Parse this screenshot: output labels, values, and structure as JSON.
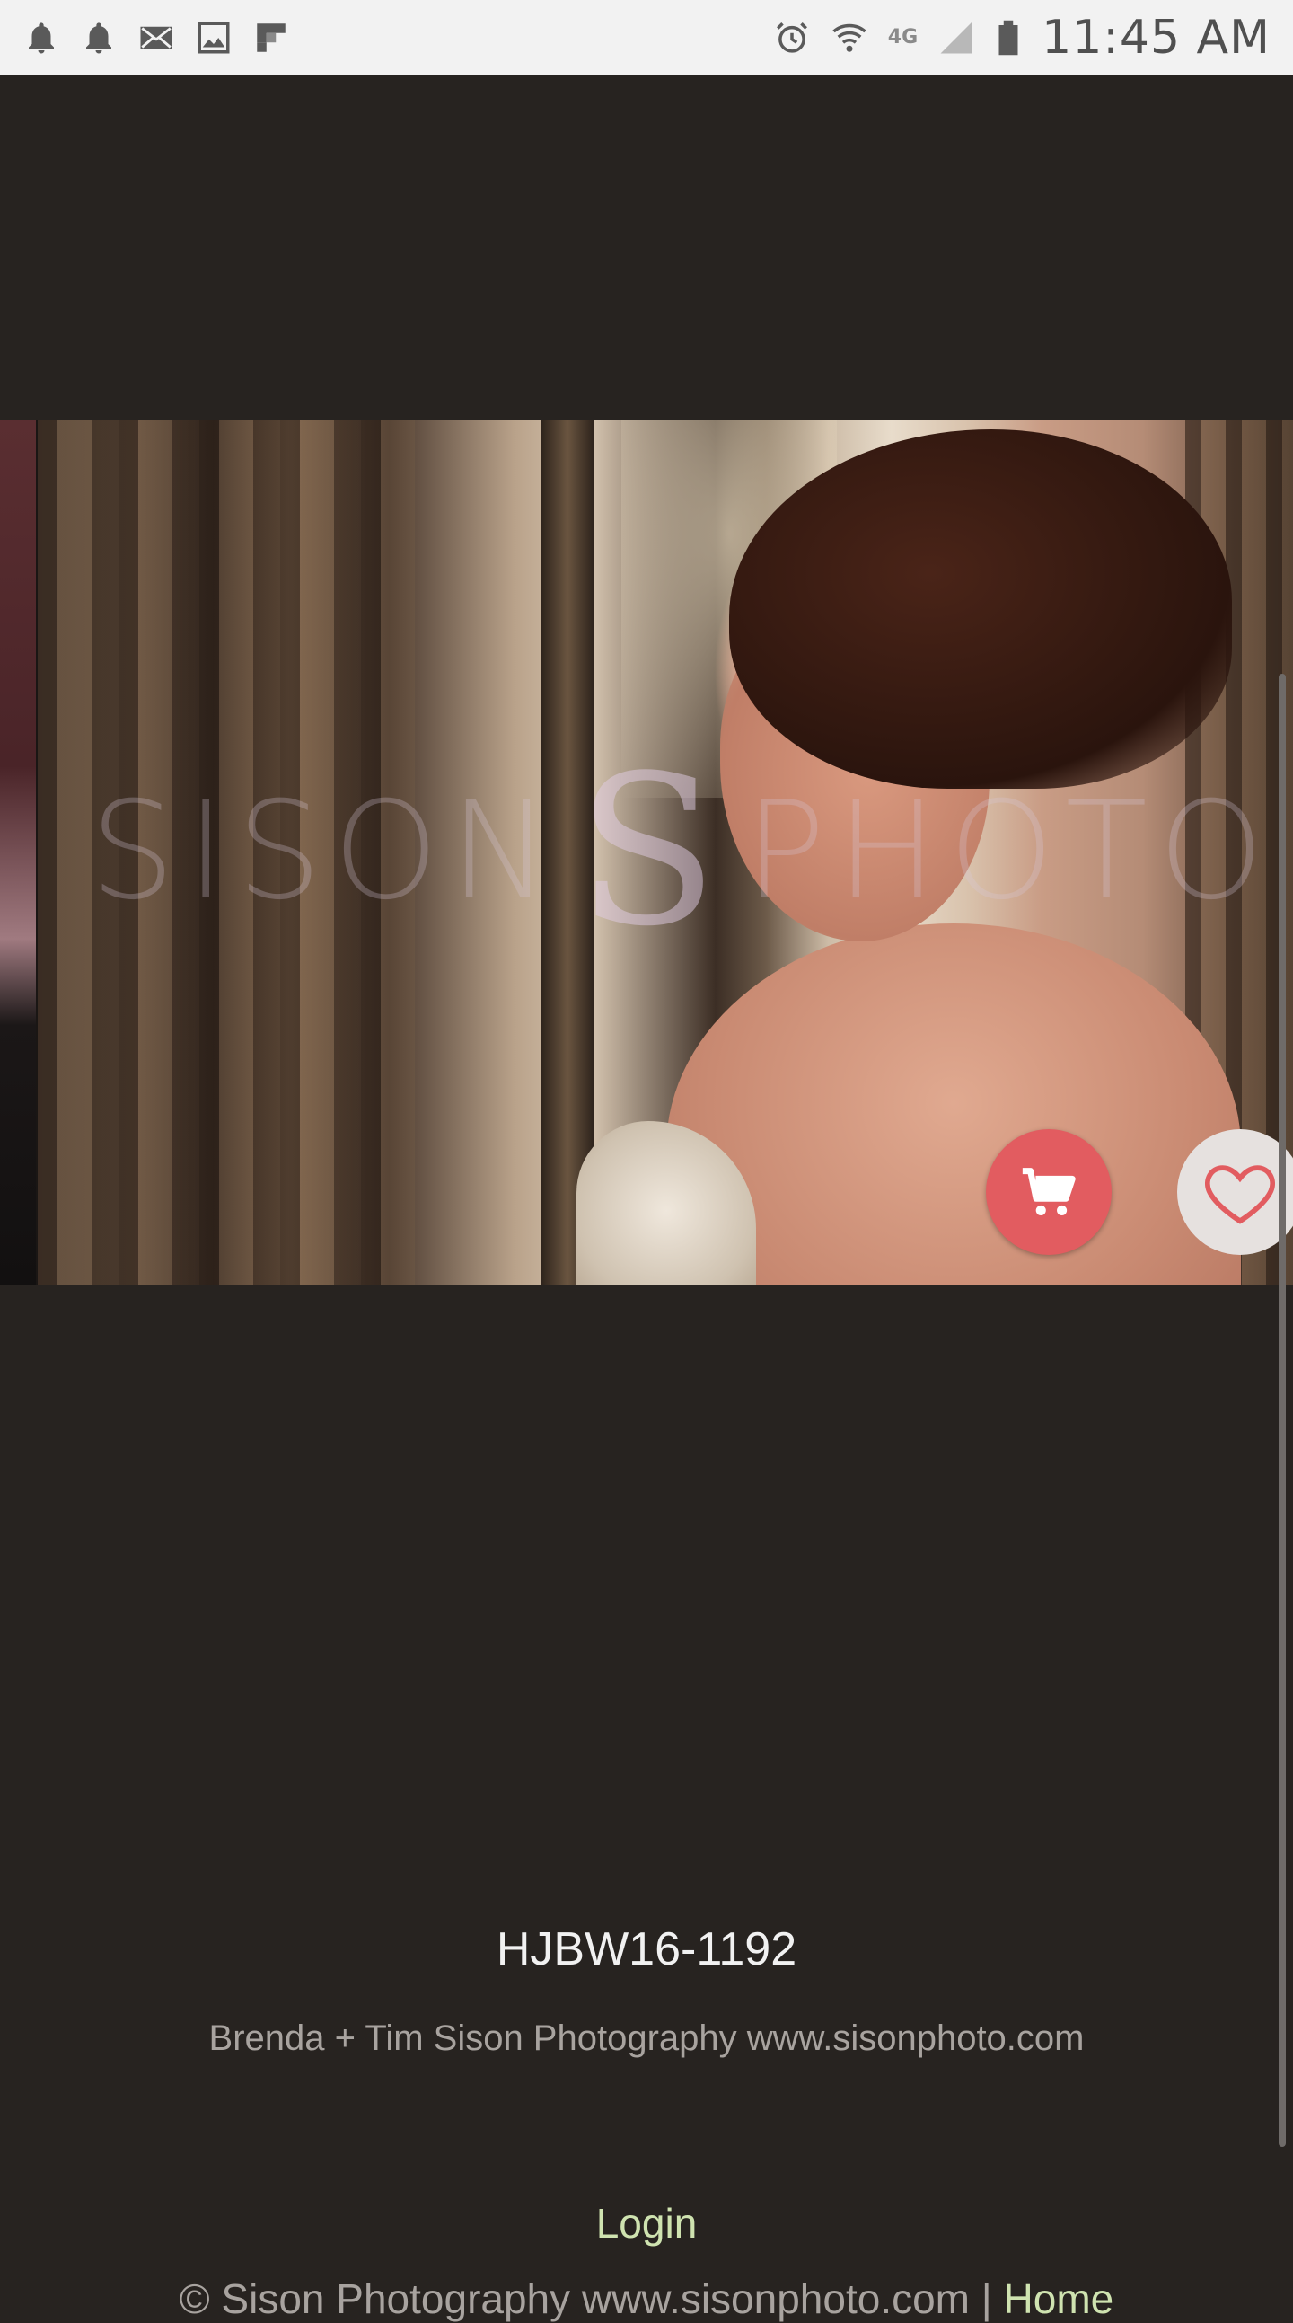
{
  "status_bar": {
    "left_icons": [
      "bell-icon",
      "bell-icon",
      "mail-icon",
      "image-icon",
      "flipboard-icon"
    ],
    "right_icons": [
      "alarm-icon",
      "wifi-icon",
      "signal-icon",
      "battery-icon"
    ],
    "network": "4G",
    "time": "11:45 AM"
  },
  "viewer": {
    "watermark_left": "SISON",
    "watermark_mark": "S",
    "watermark_right": "PHOTO",
    "cart_icon": "cart-icon",
    "favorite_icon": "heart-icon",
    "colors": {
      "cart_button": "#e25c60",
      "favorite_button": "#e6e1df"
    }
  },
  "caption": {
    "title": "HJBW16-1192",
    "credit": "Brenda + Tim Sison Photography www.sisonphoto.com"
  },
  "footer": {
    "login": "Login",
    "copyright": "© Sison Photography www.sisonphoto.com | ",
    "home": "Home"
  },
  "colors": {
    "background": "#272320",
    "link": "#cfe3b0"
  }
}
